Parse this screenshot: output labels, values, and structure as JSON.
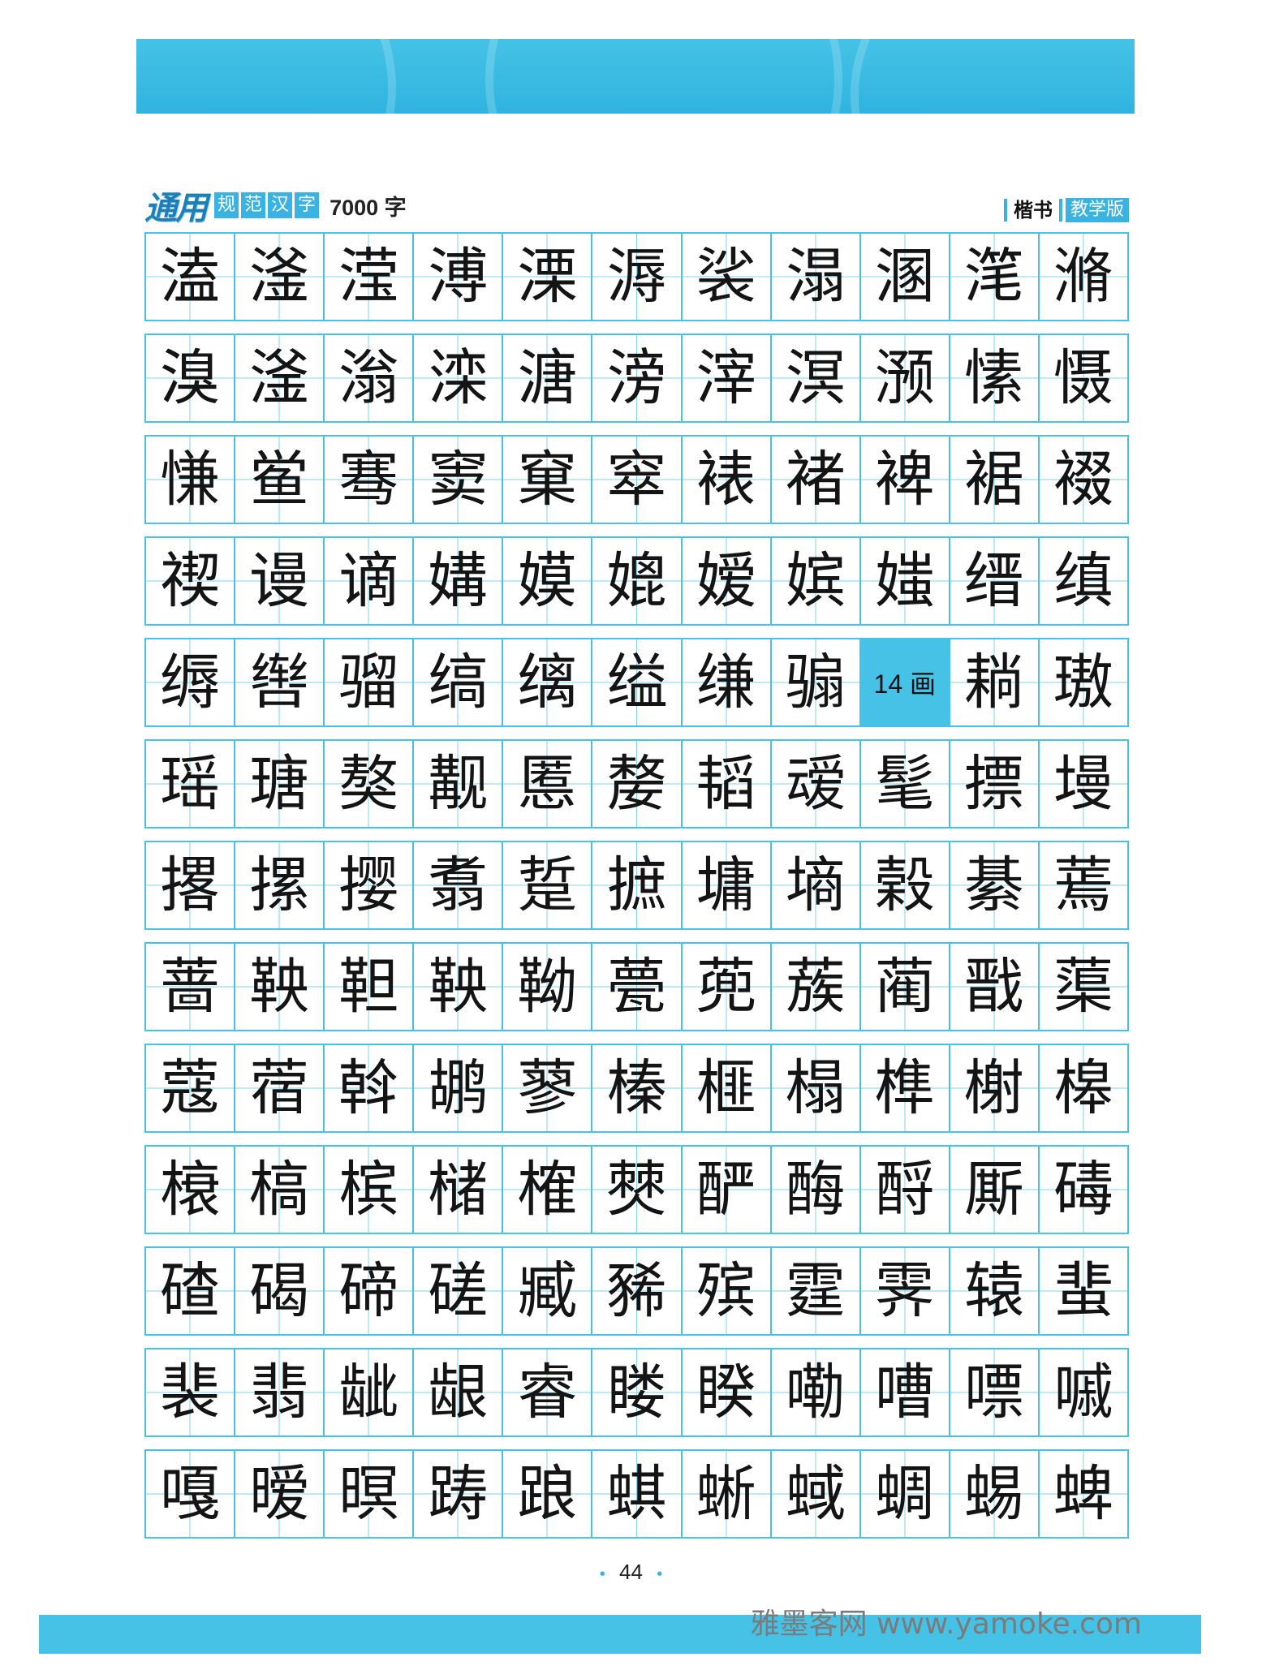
{
  "header": {
    "brand_logo": "通用",
    "brand_tags": [
      "规",
      "范",
      "汉",
      "字"
    ],
    "brand_count": "7000 字",
    "style_label": "楷书",
    "edition_label": "教学版"
  },
  "rows": [
    [
      "溘",
      "滏",
      "滢",
      "溥",
      "溧",
      "溽",
      "裟",
      "溻",
      "溷",
      "滗",
      "滫"
    ],
    [
      "溴",
      "滏",
      "滃",
      "滦",
      "溏",
      "滂",
      "滓",
      "溟",
      "滪",
      "愫",
      "慑"
    ],
    [
      "慊",
      "鲎",
      "骞",
      "窦",
      "窠",
      "窣",
      "裱",
      "褚",
      "裨",
      "裾",
      "裰"
    ],
    [
      "禊",
      "谩",
      "谪",
      "媾",
      "嫫",
      "媲",
      "嫒",
      "嫔",
      "媸",
      "缙",
      "缜"
    ],
    [
      "缛",
      "辔",
      "骝",
      "缟",
      "缡",
      "缢",
      "缣",
      "骟",
      "14 画",
      "耥",
      "璈"
    ],
    [
      "瑶",
      "瑭",
      "獒",
      "觏",
      "慝",
      "嫠",
      "韬",
      "叆",
      "髦",
      "摽",
      "墁"
    ],
    [
      "撂",
      "摞",
      "撄",
      "翥",
      "踅",
      "摭",
      "墉",
      "墒",
      "榖",
      "綦",
      "蔫"
    ],
    [
      "蔷",
      "鞅",
      "靼",
      "鞅",
      "靿",
      "甍",
      "蔸",
      "蔟",
      "蔺",
      "戬",
      "蕖"
    ],
    [
      "蔻",
      "蓿",
      "斡",
      "鹕",
      "蓼",
      "榛",
      "榧",
      "榻",
      "榫",
      "榭",
      "槔"
    ],
    [
      "榱",
      "槁",
      "槟",
      "槠",
      "榷",
      "僰",
      "酽",
      "酶",
      "酹",
      "厮",
      "碡"
    ],
    [
      "碴",
      "碣",
      "碲",
      "磋",
      "臧",
      "豨",
      "殡",
      "霆",
      "霁",
      "辕",
      "蜚"
    ],
    [
      "裴",
      "翡",
      "龇",
      "龈",
      "睿",
      "䁖",
      "睽",
      "嘞",
      "嘈",
      "嘌",
      "嘁"
    ],
    [
      "嘎",
      "暧",
      "暝",
      "踌",
      "踉",
      "蜞",
      "蜥",
      "蜮",
      "蜩",
      "蜴",
      "蜱"
    ]
  ],
  "page_number": "44",
  "watermark": "雅墨客网 www.yamoke.com"
}
